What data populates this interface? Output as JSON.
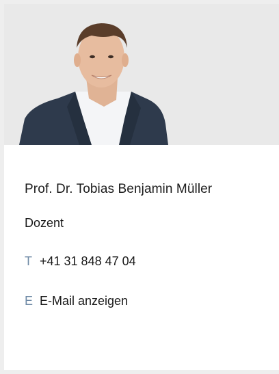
{
  "profile": {
    "name": "Prof. Dr. Tobias Benjamin Müller",
    "role": "Dozent",
    "phone_prefix": "T",
    "phone": "+41 31 848 47 04",
    "email_prefix": "E",
    "email_link": "E-Mail anzeigen"
  },
  "colors": {
    "frame": "#eeeeee",
    "photo_background": "#e9e9e9",
    "prefix_accent": "#6f8aa6",
    "text": "#1a1a1a"
  }
}
